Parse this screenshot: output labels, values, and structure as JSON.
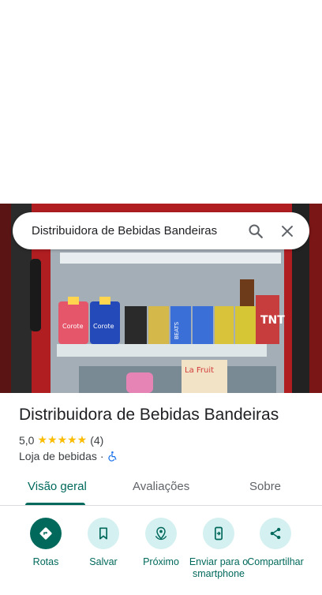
{
  "search": {
    "query": "Distribuidora de Bebidas Bandeiras"
  },
  "photo": {
    "cans": [
      "",
      "",
      "BEATS",
      "",
      "",
      ""
    ],
    "bottles": [
      "Corote",
      "Corote"
    ],
    "can_tnt": "TNT",
    "lower_box": "La Fruit"
  },
  "place": {
    "title": "Distribuidora de Bebidas Bandeiras",
    "rating": "5,0",
    "stars": "★★★★★",
    "review_count": "(4)",
    "category": "Loja de bebidas",
    "separator": "·"
  },
  "tabs": [
    {
      "label": "Visão geral",
      "active": true
    },
    {
      "label": "Avaliações",
      "active": false
    },
    {
      "label": "Sobre",
      "active": false
    }
  ],
  "actions": [
    {
      "label": "Rotas",
      "icon": "directions-icon"
    },
    {
      "label": "Salvar",
      "icon": "bookmark-icon"
    },
    {
      "label": "Próximo",
      "icon": "nearby-icon"
    },
    {
      "label": "Enviar para o smartphone",
      "icon": "send-to-phone-icon"
    },
    {
      "label": "Compartilhar",
      "icon": "share-icon"
    }
  ],
  "colors": {
    "accent": "#00695c",
    "action_bg": "#d4f0f0",
    "star": "#fbbc04",
    "accessible": "#1a73e8"
  }
}
